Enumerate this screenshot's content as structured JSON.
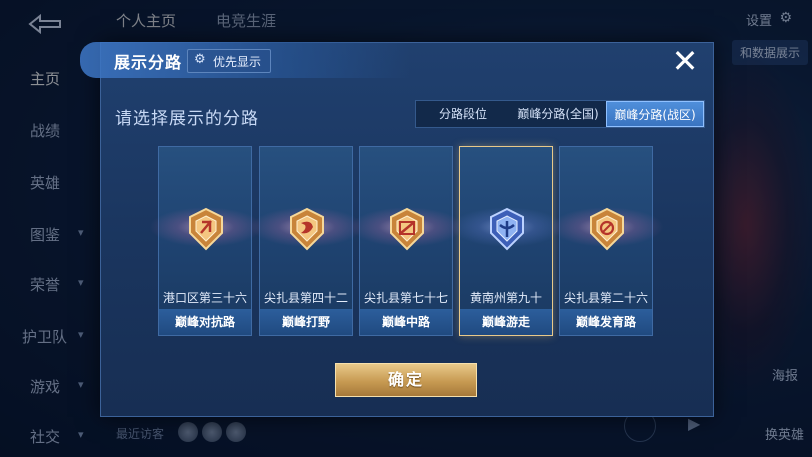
{
  "background": {
    "top_tabs": [
      "个人主页",
      "电竞生涯"
    ],
    "settings_label": "设置",
    "data_display_label": "和数据展示",
    "sidebar": [
      "主页",
      "战绩",
      "英雄",
      "图鉴",
      "荣誉",
      "护卫队",
      "游戏",
      "社交"
    ],
    "recent_visitors_label": "最近访客",
    "report_label": "海报",
    "change_hero_label": "换英雄"
  },
  "modal": {
    "title": "展示分路",
    "priority_button": "优先显示",
    "close_symbol": "✕",
    "subtitle": "请选择展示的分路",
    "segments": [
      "分路段位",
      "巅峰分路(全国)",
      "巅峰分路(战区)"
    ],
    "active_segment": 2,
    "cards": [
      {
        "region": "港口区第三十六",
        "lane": "巅峰对抗路",
        "selected": false,
        "theme": "gold"
      },
      {
        "region": "尖扎县第四十二",
        "lane": "巅峰打野",
        "selected": false,
        "theme": "gold"
      },
      {
        "region": "尖扎县第七十七",
        "lane": "巅峰中路",
        "selected": false,
        "theme": "gold"
      },
      {
        "region": "黄南州第九十",
        "lane": "巅峰游走",
        "selected": true,
        "theme": "blue"
      },
      {
        "region": "尖扎县第二十六",
        "lane": "巅峰发育路",
        "selected": false,
        "theme": "gold"
      }
    ],
    "confirm_label": "确定"
  },
  "colors": {
    "gold": "#e8c98a",
    "accent_blue": "#4f8fdb",
    "modal_bg": "#1f3d6a"
  }
}
